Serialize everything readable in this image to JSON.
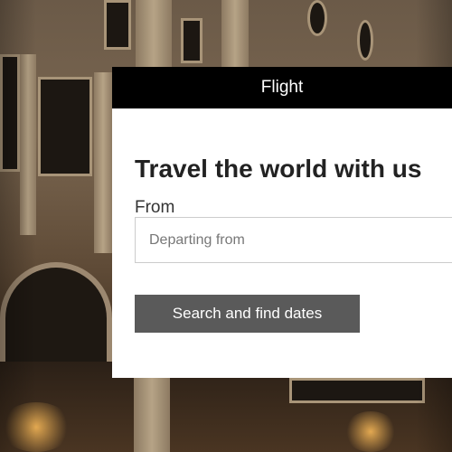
{
  "header": {
    "title": "Flight"
  },
  "form": {
    "heading": "Travel the world with us",
    "from_label": "From",
    "from_placeholder": "Departing from",
    "from_value": "",
    "submit_label": "Search and find dates"
  },
  "colors": {
    "header_bg": "#000000",
    "card_bg": "#ffffff",
    "button_bg": "#5a5a5a"
  }
}
